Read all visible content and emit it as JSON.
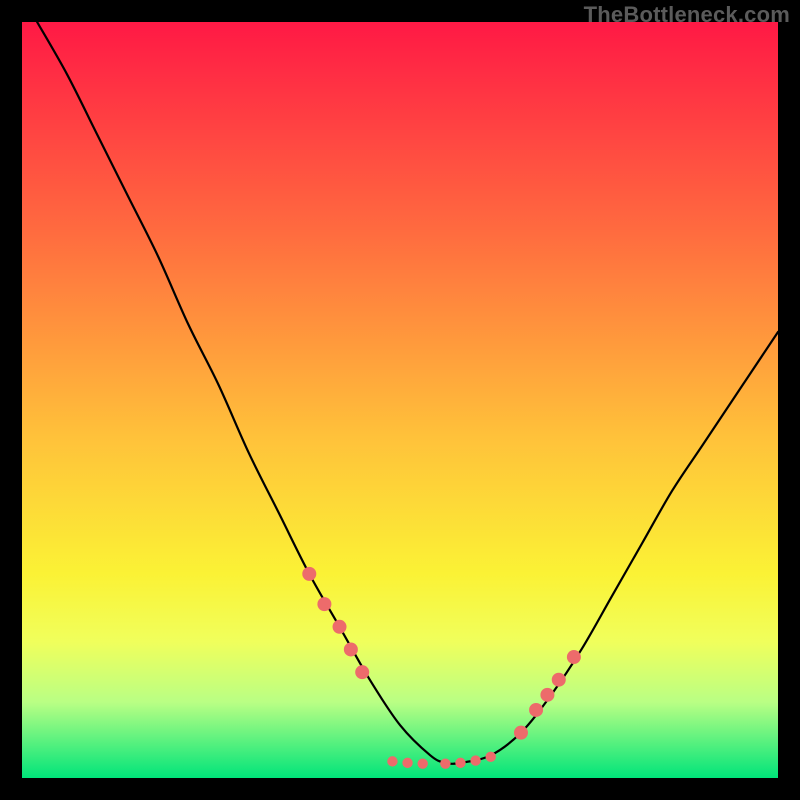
{
  "watermark": "TheBottleneck.com",
  "chart_data": {
    "type": "line",
    "title": "",
    "xlabel": "",
    "ylabel": "",
    "xlim": [
      0,
      100
    ],
    "ylim": [
      0,
      100
    ],
    "background_gradient": [
      "#ff1945",
      "#ff6c3f",
      "#ffc23a",
      "#fbf235",
      "#f0ff5c",
      "#b9ff84",
      "#00e47a"
    ],
    "gradient_stops_pct": [
      0,
      28,
      55,
      73,
      82,
      90,
      100
    ],
    "series": [
      {
        "name": "bottleneck-curve",
        "color": "#000000",
        "x": [
          2,
          6,
          10,
          14,
          18,
          22,
          26,
          30,
          34,
          38,
          42,
          46,
          50,
          54,
          56,
          58,
          62,
          66,
          70,
          74,
          78,
          82,
          86,
          90,
          94,
          98,
          100
        ],
        "y": [
          100,
          93,
          85,
          77,
          69,
          60,
          52,
          43,
          35,
          27,
          20,
          13,
          7,
          3,
          2,
          2,
          3,
          6,
          11,
          17,
          24,
          31,
          38,
          44,
          50,
          56,
          59
        ]
      }
    ],
    "markers": {
      "name": "performance-markers",
      "color": "#ed6b6b",
      "radius_large": 7,
      "radius_small": 5.2,
      "points_large": [
        {
          "x": 38,
          "y": 27
        },
        {
          "x": 40,
          "y": 23
        },
        {
          "x": 42,
          "y": 20
        },
        {
          "x": 43.5,
          "y": 17
        },
        {
          "x": 45,
          "y": 14
        },
        {
          "x": 66,
          "y": 6
        },
        {
          "x": 68,
          "y": 9
        },
        {
          "x": 69.5,
          "y": 11
        },
        {
          "x": 71,
          "y": 13
        },
        {
          "x": 73,
          "y": 16
        }
      ],
      "points_small": [
        {
          "x": 49,
          "y": 2.2
        },
        {
          "x": 51,
          "y": 2.0
        },
        {
          "x": 53,
          "y": 1.9
        },
        {
          "x": 56,
          "y": 1.9
        },
        {
          "x": 58,
          "y": 2.0
        },
        {
          "x": 60,
          "y": 2.3
        },
        {
          "x": 62,
          "y": 2.8
        }
      ]
    }
  }
}
